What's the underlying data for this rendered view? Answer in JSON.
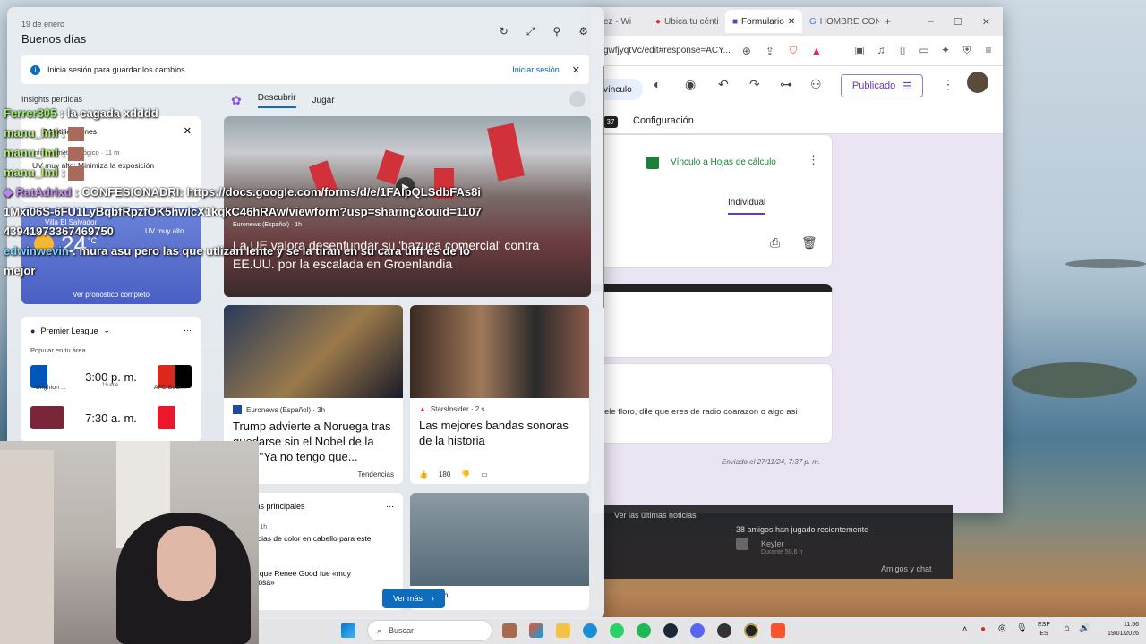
{
  "browser": {
    "tabs": [
      {
        "label": "ez - Wi"
      },
      {
        "label": "Ubica tu cénti"
      },
      {
        "label": "Formulario"
      },
      {
        "label": "HOMBRE CON"
      }
    ],
    "url": "gwfjyqtVc/edit#response=ACY..."
  },
  "forms": {
    "link_label": "vínculo",
    "published_label": "Publicado",
    "badge": "37",
    "config_tab": "Configuración",
    "sheets_link": "Vínculo a Hojas de cálculo",
    "individual_tab": "Individual",
    "response_text": "ele floro, dile que eres de radio coarazon o algo asi",
    "sent_text": "Enviado el 27/11/24, 7:37 p. m."
  },
  "game_panel": {
    "news_link": "Ver las últimas noticias",
    "friends_played": "38 amigos han jugado recientemente",
    "friend_name": "Keyler",
    "friend_status": "Durante 50,6 h",
    "friends_chat": "Amigos y chat"
  },
  "widgets": {
    "date": "19 de enero",
    "greeting": "Buenos días",
    "signin_message": "Inicia sesión para guardar los cambios",
    "signin_link": "Iniciar sesión",
    "insights": "Insights perdidas",
    "notifications_title": "2 Notificaciones",
    "notif_source": "Informe meteorológico · 11 m",
    "notif_text": "UV muy alto: Minimiza la exposición",
    "weather_location": "Villa El Salvador",
    "weather_temp": "24",
    "weather_unit": "°C",
    "weather_alert": "UV muy alto",
    "weather_alert_sub": "solar.",
    "weather_more": "Ver pronóstico completo",
    "sports_league": "Premier League",
    "sports_sub": "Popular en tu área",
    "matches": [
      {
        "time": "3:00 p. m.",
        "date": "19 ene.",
        "home": "Brighton ...",
        "away": "AFC Bour..."
      },
      {
        "time": "7:30 a. m.",
        "date": "",
        "home": "",
        "away": ""
      }
    ],
    "feed_tabs": [
      "Descubrir",
      "Jugar"
    ],
    "hero": {
      "source": "Euronews (Español) · 1h",
      "title": "La UE valora desenfundar su 'bazuca comercial' contra EE.UU. por la escalada en Groenlandia"
    },
    "cards": [
      {
        "source": "Euronews (Español) · 3h",
        "title": "Trump advierte a Noruega tras quedarse sin el Nobel de la Paz: \"Ya no tengo que...",
        "trend": "Tendencias"
      },
      {
        "source": "StarsInsider · 2 s",
        "title": "Las mejores bandas sonoras de la historia",
        "likes": "180"
      }
    ],
    "top_stories": "Historias principales",
    "top_story_1_src": "Popular · 1h",
    "top_story_1": "Tendencias de color en cabello para este",
    "top_story_2_src": "2h",
    "top_story_2": "Lo dice que Renee Good fue «muy respetuosa»",
    "small_src": "RPP · 1h",
    "more_button": "Ver más"
  },
  "chat": [
    {
      "user": "Ferrer305",
      "msg": ": la cagada xdddd"
    },
    {
      "user": "manu_lml",
      "msg": ":"
    },
    {
      "user": "manu_lml",
      "msg": ":"
    },
    {
      "user": "manu_lml",
      "msg": ":"
    },
    {
      "user": "RatAdrixd",
      "msg": ": CONFESIONADRI: https://docs.google.com/forms/d/e/1FAIpQLSdbFAs8i1Mxi06S-6FU1LyBqbfRpzfOK5hwlcX1kqkC46hRAw/viewform?usp=sharing&ouid=110743941973367469750"
    },
    {
      "user": "edwinwevin",
      "msg": ": mura asu pero las que utlizan lente y se la tiran en su cara ufff es de lo mejor"
    }
  ],
  "taskbar": {
    "search_label": "Buscar",
    "lang_top": "ESP",
    "lang_bottom": "ES",
    "time": "11:56",
    "date": "19/01/2026"
  },
  "colors": {
    "accent": "#0f6cbd",
    "forms_purple": "#673ab7",
    "sheets_green": "#188038"
  }
}
